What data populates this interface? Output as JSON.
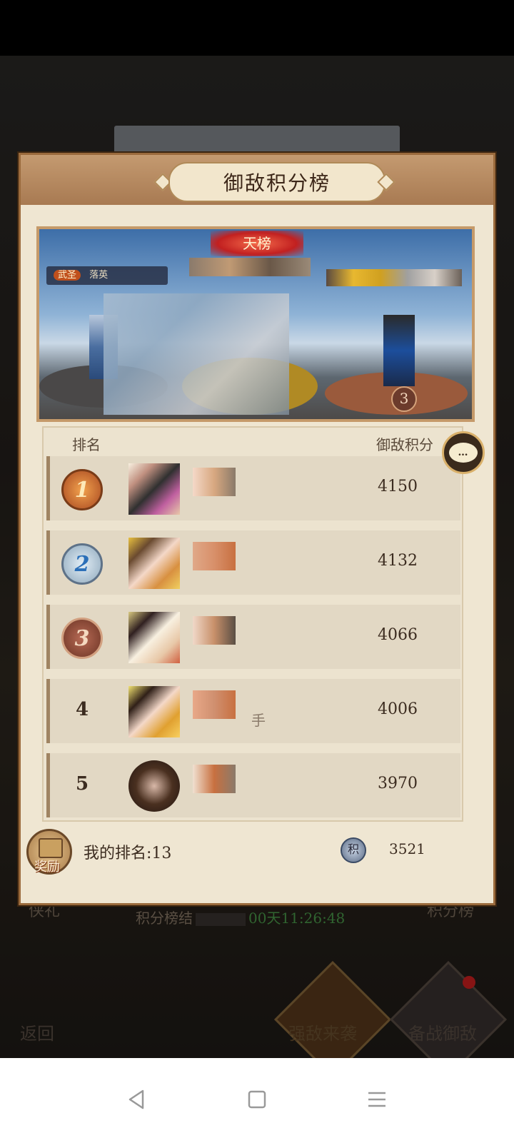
{
  "title": "御敌积分榜",
  "banner": {
    "badge_text": "天榜",
    "left_tag_label": "武圣",
    "left_tag_name": "落英",
    "third_place_label": "3"
  },
  "list": {
    "header_rank": "排名",
    "header_score": "御敌积分",
    "rows": [
      {
        "rank": "1",
        "score": "4150"
      },
      {
        "rank": "2",
        "score": "4132"
      },
      {
        "rank": "3",
        "score": "4066"
      },
      {
        "rank": "4",
        "score": "4006",
        "name_suffix": "手"
      },
      {
        "rank": "5",
        "score": "3970"
      }
    ]
  },
  "my_rank": {
    "reward_label": "奖励",
    "text": "我的排名:13",
    "points_icon_label": "积",
    "score": "3521"
  },
  "chat_icon_label": "…",
  "behind": {
    "left_button": "侠礼",
    "right_button": "积分榜",
    "timer_label": "积分榜结",
    "timer_value": "00天11:26:48",
    "back_button": "返回",
    "mid_button": "强敌来袭",
    "right_bottom_button": "备战御敌"
  },
  "colors": {
    "accent_gold": "#b08a58",
    "panel_bg": "#efe6d2",
    "timer_green": "#4a9a4a",
    "notification_red": "#d02020"
  }
}
